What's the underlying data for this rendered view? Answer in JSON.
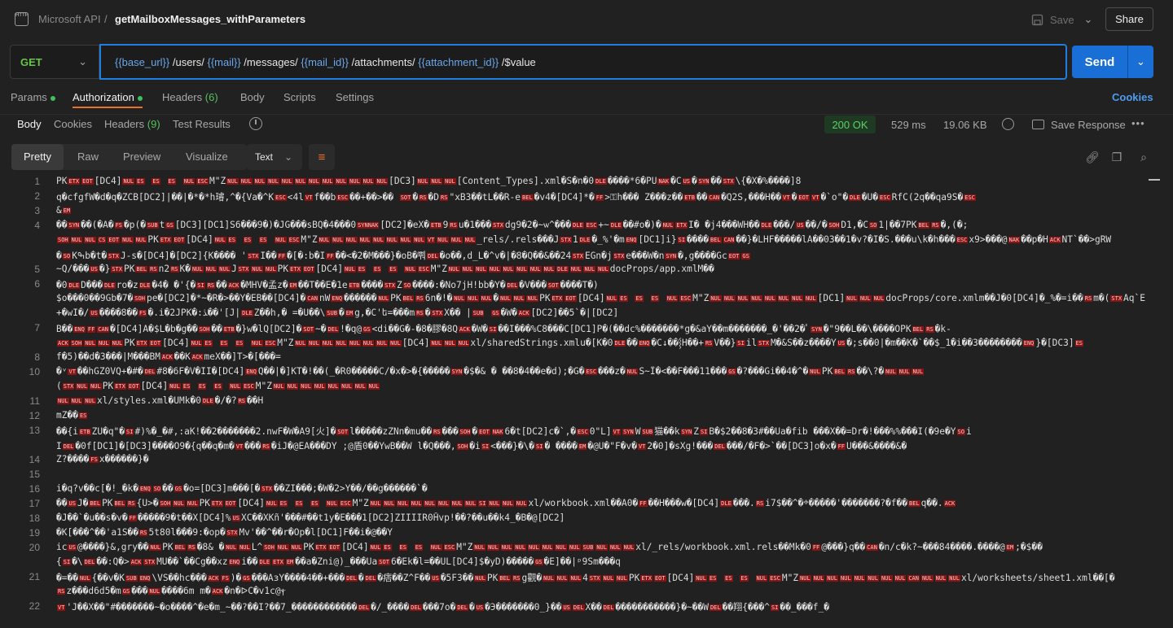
{
  "header": {
    "app_icon": "http-icon",
    "workspace": "Microsoft API",
    "separator": "/",
    "request_name": "getMailboxMessages_withParameters",
    "save_label": "Save",
    "share_label": "Share"
  },
  "request": {
    "method": "GET",
    "url_parts": [
      "{{base_url}}",
      " /users/ ",
      "{{mail}}",
      " /messages/ ",
      "{{mail_id}}",
      " /attachments/ ",
      "{{attachment_id}}",
      " /$value"
    ],
    "send_label": "Send"
  },
  "request_tabs": {
    "params": "Params",
    "authorization": "Authorization",
    "headers": "Headers",
    "headers_count": "(6)",
    "body": "Body",
    "scripts": "Scripts",
    "settings": "Settings",
    "cookies": "Cookies"
  },
  "response_tabs": {
    "body": "Body",
    "cookies": "Cookies",
    "headers": "Headers",
    "headers_count": "(9)",
    "test_results": "Test Results"
  },
  "response_meta": {
    "status": "200 OK",
    "time": "529 ms",
    "size": "19.06 KB",
    "save_response": "Save Response"
  },
  "view": {
    "pretty": "Pretty",
    "raw": "Raw",
    "preview": "Preview",
    "visualize": "Visualize",
    "format": "Text"
  },
  "colors": {
    "accent": "#1a6fd6",
    "active_tab_underline": "#e8702a",
    "status_ok": "#5ed068",
    "control_char_bg": "#8a1414"
  },
  "code_lines": [
    {
      "n": "1",
      "t": "PK[ETX][EOT][DC4][NUL][ES] [ES] [ES] [NUL][ESC]M\"Z[NUL][NUL][NUL][NUL][NUL][NUL][NUL][NUL][NUL][NUL][NUL][NUL][DC3][NUL][NUL][NUL][Content_Types].xml�S�n�0[DLE]����*6�PU[NAK]�C[US]�[SYN]��[STX]\\{�X�%����]8"
    },
    {
      "n": "2",
      "t": "q�cfgfW�d�q�ZCB[DC2]|��|�*�*h璿,^�{Va�^K[ESC]<4l[VT]f��b[ESC]��+��>��  [SOT]�[RS]�D[RS]\"xB3��tL��R-e[BEL]�v4�[DC4]*�[FF]>⚿h���  Z���z��[ETB]��[CAN]�Q2S,���H��[VT]�[EOT][VT]�`o\"�[DLE]�U�[ESC]RfC(2q��qa9S�[ESC]"
    },
    {
      "n": "3",
      "t": "&[EM]"
    },
    {
      "n": "4",
      "t": "��[SYN]��(�A�[FS]�p(�[SUB]t[GS][DC3][DC1]S6���9�)�JG���sBQ�4���0[SYNNAK][DC2]�eX�[ETB]9[RS]u�1���[STX]dg9�2�~ѡ^���[DLE][ESC]+~[DLE]��#o�)�[NUL][ETX]I�   �j4���WH��[DLE]���/[US]��/�[SOH]D1,�C[SO]1|��7PK[BEL][RS]�,(�;"
    },
    {
      "n": "",
      "t": "[SOH][NUL][NUL][CS][EOT][NUL][NUL]PK[ETX][EOT][DC4][NUL][ES] [ES] [ES] [NUL][ESC]M\"Z[NUL][NUL][NUL][NUL][NUL][NUL][NUL][NUL][VT][NUL][NUL][NUL]_rels/.rels���J[STX]1[DLE]�_%'�m[ENQ][DC1]i}[SI]����[BEL][CAN]��}�LHF�����lA��03��1�v?�I�S.���u\\k�h���[ESC]x9>���@[NAK]��p�H[ACK]NT`��>gRW"
    },
    {
      "n": "",
      "t": "�[SO]Kߒb�t�[STX]J-s�[DC4]�[DC2]{K���� '[STX]I��[FF]�[�:b�I[FF]��<�2�M���}�oB�뿨[DEL]�o��,d_L�^v�|�8�Q��&��24[STX]EGn�j[STX]e���W�n[SYN]�,g����Gc[EOT][GS]"
    },
    {
      "n": "5",
      "t": "~Q/���[US]�}[STX]PK[BEL][RS]n2[RS]K�[NUL][NUL][NUL]J[STX][NUL][NUL]PK[ETX][EOT][DC4][NUL][ES] [ES] [ES] [NUL][ESC]M\"Z[NUL][NUL][NUL][NUL][NUL][NUL][NUL][NUL][DLE][NUL][NUL][NUL]docProps/app.xmlM��"
    },
    {
      "n": "6",
      "t": "�0[DLE]D���[DLE]ro�z[DLE]�4� �'{�[SI][RS]��[ACK]�MHV�孟z�[EM]��T��E�1e[ETB]����[STX]Z[SO]����:�No7jH!bb�Y�[DEL]�V���[SOT]����T�)"
    },
    {
      "n": "",
      "t": "$o���0��9Gb�7�[SOH]pe�[DC2]�*~�R�>��Y�EB��[DC4]�[CAN]nW[ENQ]������[NUL]PK[BEL][RS]6n�!�[NUL][NUL][NUL]�[NUL][NUL][NUL]PK[ETX][EOT][DC4][NUL][ES] [ES] [ES] [NUL][ESC]M\"Z[NUL][NUL][NUL][NUL][NUL][NUL][NUL][NUL][DC1][NUL][NUL][NUL]docProps/core.xmlm��J�0[DC4]�_%�=i��[RS]m�([STX]Aq`E"
    },
    {
      "n": "",
      "t": "+�wI�/[US]����8��[FS]�.i�2JPK�:ﮇ��'[J|[DLE]Z��h,� =�U��\\[SUB]�[EM]g,�C'ե=���m[RS]�[STX]X��  |[SUB]   [GS]�W�[ACK][DC2]��5`�|[DC2]"
    },
    {
      "n": "7",
      "t": "B��[ENQ][FF][CAN]�[DC4]A�$L�b�g��[SOH]��[ETB]�}w�lQ[DC2]�[SOT]~�[DEL]!�q@[GS]<di��G�-�8�膠�8Q[ACK]�W�[SI]��I���%C8���C[DC1]P�(��dc%�������*g�&aY��m�������_�'��2�ﾟ[SYN]�\"9��L��\\����OPK[BEL][RS]�k-"
    },
    {
      "n": "",
      "t": "[ACK][SOH][NUL][NUL][NUL]PK[ETX][EOT][DC4][NUL][ES] [ES] [ES] [NUL][ESC]M\"Z[NUL][NUL][NUL][NUL][NUL][NUL][NUL][NUL][DC4][NUL][NUL][NUL]xl/sharedStrings.xmlu�[K�0[DLE]��[ENQ]�C↓��⸾H��+[RS]V��}[SI]il[STX]M�&S��z����Y[US]�;s��0|�m��K�`��$_1�i��3��������[ENQ]}�[DC3][ES]"
    },
    {
      "n": "8",
      "t": "f�5)��d�3���|M���BM[ACK]��K[ACK]meX��]T>�[���="
    },
    {
      "n": "10",
      "t": "�ᵛ[VT]��hGZ0VQ+�#�[DEL]#8�6F�V�II�[DC4][ENQ]Q��|�]KT�!��(_�R0�����C/�x�>�{�����[SYN]�$�& �    ��8�4��e�d);�G�[ESC]���z�[NUL]S~Ï�<��F���11���[GS]�?���Gi��4�^�[NUL]PK[BEL][RS]��\\?�[NUL][NUL][NUL]"
    },
    {
      "n": "",
      "t": "([STX][NUL][NUL]PK[ETX][EOT][DC4][NUL][ES] [ES] [ES] [NUL][ESC]M\"Z[NUL][NUL][NUL][NUL][NUL][NUL][NUL][NUL]"
    },
    {
      "n": "11",
      "t": "[NUL][NUL][NUL]xl/styles.xml�UMk�0[DLE]�/�?[RS]��H"
    },
    {
      "n": "12",
      "t": "mZ��[ES]"
    },
    {
      "n": "13",
      "t": "��{i[ETB]ZU�q\"�[SI]#)%�_�#,:aK!��2�������2.nwF�W�A9[火]�[SOT]l�����zZNn�mu��[RS]���[SOH]�[EOT][NAK]6�t[DC2]c�`,�[ESC]0\"L][VT][SYN]W[SUB]猫��k[SYN]Z[SI]B�$2��8�3#��Ua�fib ���X��=Dr�!���%%���I(�9e�Y[SO]i"
    },
    {
      "n": "",
      "t": "I[DEL]�0f[DC1]�[DC3]����O9�{q��q�m�[VT]���[RS]�iJ�@EA���DY ;@盾0��YwB��W   l�Q���,[SOH]�i[SI]<���}�\\�[SI]�   ����[EM]�@U�\"F�v�[VT]2�0]�sXg!���[DEL]���/�F�>`��[DC3]o�x�[FF]U���&����&�"
    },
    {
      "n": "14",
      "t": "Z?����[FS]x������}�"
    },
    {
      "n": "15",
      "t": ""
    },
    {
      "n": "16",
      "t": "i�q?v��c[�!_�k�[ENQ][SO]��[GS]�o=[DC3]m���[�[STX]��ZI���;�W�2>Y��/��g������`�"
    },
    {
      "n": "17",
      "t": "��[US]J�[BEL]PK[BEL][RS]{U>�[SOH][NUL][NUL]PK[ETX][EOT][DC4][NUL][ES] [ES] [ES] [NUL][ESC]M\"Z[NUL][NUL][NUL][NUL][NUL][NUL][NUL][NUL][SI][NUL][NUL][NUL]xl/workbook.xml��A0�[FF]��H���w�[DC4][DLE]���.[RS]i7$��^�ⱚ�����'�������?�f��[BEL]q��.[ACK]"
    },
    {
      "n": "18",
      "t": "�J��`�u��s�v�[FF]�����9�t��X[DC4]%[US]XC��XKñ'���#��t1y�E���1[DC2]ZIIIIR0H̊vp!��?��u��k4_�B�@[DC2]"
    },
    {
      "n": "19",
      "t": "�K[���^��'a1S��[RS]5t80l���9:�op�[STX]Mv'��^��r�Op�l[DC1]F��i�@��Y"
    },
    {
      "n": "20",
      "t": "ic[US]@����}&,gry��[NUL]PK[BEL][RS]�8& �[NUL][NUL]L^[SOH][NUL][NUL]PK[ETX][EOT][DC4][NUL][ES] [ES] [ES] [NUL][ESC]M\"Z[NUL][NUL][NUL][NUL][NUL][NUL][NUL][NUL][SUB][NUL][NUL][NUL]xl/_rels/workbook.xml.rels��Mk�0[FF]@���}q��[CAN]�n/c�k?~���84����.����@[EM];�$��"
    },
    {
      "n": "",
      "t": "{[SI]�\\[DEL]��:Q�>[ACK][STX]MU��`��Cg��xz[ENQ]i��[DLE][ETX][EM]��a�Zni@)_���Ua[SOT]6�Ek�l=��UL[DC4]$�yD)�����[GS]�E]��|ᵖ9Sm���q"
    },
    {
      "n": "21",
      "t": "�=��[NUL]{��v�K[SUB][ENQ]\\VS��hc���[ACK][FS])�[GS]���AɜY����4��+���[DEL]�[DEL]�痞��Z^F��[US]�5F3��[NUL]PK[BEL][RS]g觀�[NUL][NUL][NUL]4[STX][NUL][NUL]PK[ETX][EOT][DC4][NUL][ES] [ES] [ES] [NUL][ESC]M\"Z[NUL][NUL][NUL][NUL][NUL][NUL][NUL][NUL][CAN][NUL][NUL][NUL]xl/worksheets/sheet1.xml��[�"
    },
    {
      "n": "",
      "t": "[RS]z���d6d5�m[GS]���[NUL]����6m  m�[ACK]�n�ᐅC�v1c@ⲯ"
    },
    {
      "n": "22",
      "t": "[VT]'J��X��\"#�������~�o����^�e�m_~��?��I?��7_������������[DEL]�/_����[DEL]���7o�[DEL]�[US]�Э�������0_}��[US][DEL]X��[DEL]�����������}�~��W[DEL]��翔{���^[SI]��_���f_�"
    }
  ]
}
